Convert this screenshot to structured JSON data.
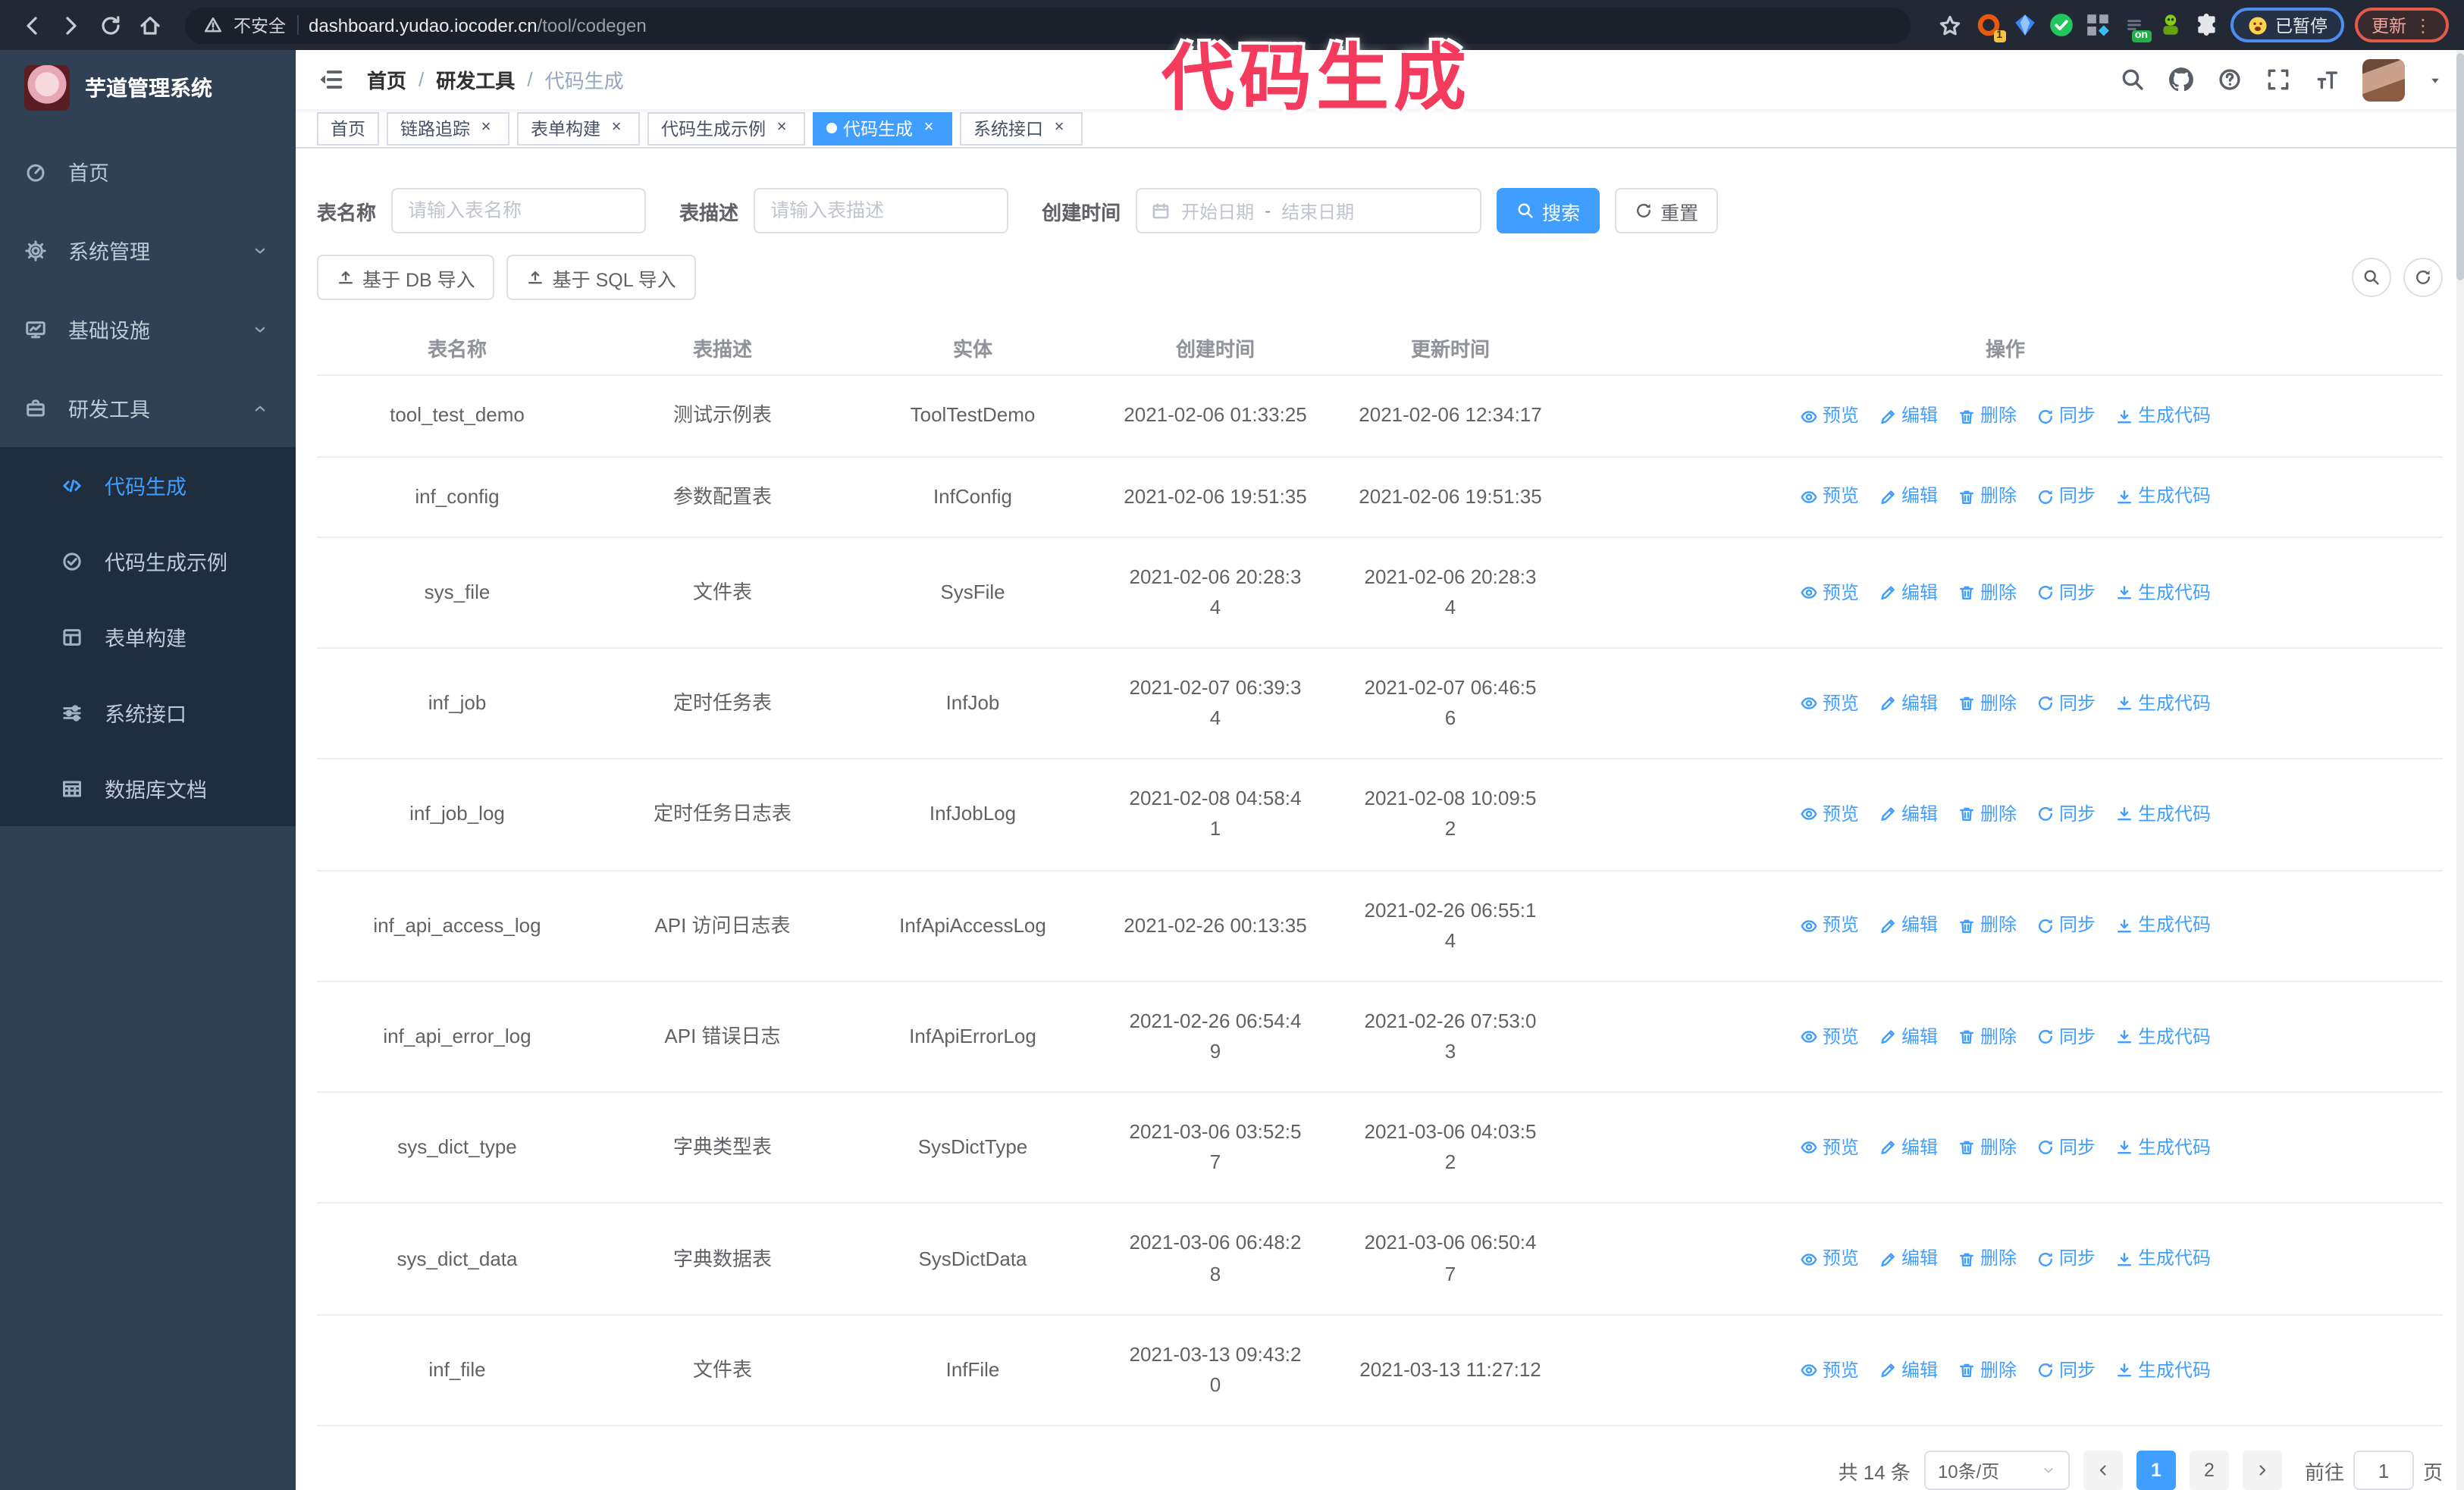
{
  "browser": {
    "security_label": "不安全",
    "url_host": "dashboard.yudao.iocoder.cn",
    "url_path": "/tool/codegen",
    "paused_badge": "已暂停",
    "update_button": "更新"
  },
  "overlay_title": "代码生成",
  "sidebar": {
    "app_title": "芋道管理系统",
    "items": [
      {
        "id": "home",
        "label": "首页",
        "icon": "dashboard-icon",
        "type": "item"
      },
      {
        "id": "system-management",
        "label": "系统管理",
        "icon": "gear-icon",
        "type": "group",
        "expanded": false
      },
      {
        "id": "infrastructure",
        "label": "基础设施",
        "icon": "monitor-icon",
        "type": "group",
        "expanded": false
      },
      {
        "id": "dev-tools",
        "label": "研发工具",
        "icon": "toolbox-icon",
        "type": "group",
        "expanded": true,
        "children": [
          {
            "id": "codegen",
            "label": "代码生成",
            "icon": "code-icon",
            "active": true
          },
          {
            "id": "codegen-example",
            "label": "代码生成示例",
            "icon": "badge-check-icon"
          },
          {
            "id": "form-builder",
            "label": "表单构建",
            "icon": "form-icon"
          },
          {
            "id": "system-api",
            "label": "系统接口",
            "icon": "sliders-icon"
          },
          {
            "id": "db-doc",
            "label": "数据库文档",
            "icon": "database-icon"
          }
        ]
      }
    ]
  },
  "header": {
    "breadcrumb": [
      "首页",
      "研发工具",
      "代码生成"
    ],
    "breadcrumb_separator": "/"
  },
  "tabs": [
    {
      "id": "home",
      "label": "首页",
      "closable": false,
      "active": false
    },
    {
      "id": "tracing",
      "label": "链路追踪",
      "closable": true,
      "active": false
    },
    {
      "id": "form-builder",
      "label": "表单构建",
      "closable": true,
      "active": false
    },
    {
      "id": "codegen-example",
      "label": "代码生成示例",
      "closable": true,
      "active": false
    },
    {
      "id": "codegen",
      "label": "代码生成",
      "closable": true,
      "active": true
    },
    {
      "id": "system-api",
      "label": "系统接口",
      "closable": true,
      "active": false
    }
  ],
  "filters": {
    "table_name_label": "表名称",
    "table_name_placeholder": "请输入表名称",
    "table_desc_label": "表描述",
    "table_desc_placeholder": "请输入表描述",
    "create_time_label": "创建时间",
    "start_placeholder": "开始日期",
    "range_separator": "-",
    "end_placeholder": "结束日期",
    "search_label": "搜索",
    "reset_label": "重置"
  },
  "toolbar": {
    "import_db_label": "基于 DB 导入",
    "import_sql_label": "基于 SQL 导入"
  },
  "table": {
    "columns": [
      "表名称",
      "表描述",
      "实体",
      "创建时间",
      "更新时间",
      "操作"
    ],
    "actions": [
      {
        "id": "preview",
        "label": "预览",
        "icon": "eye-icon"
      },
      {
        "id": "edit",
        "label": "编辑",
        "icon": "edit-icon"
      },
      {
        "id": "delete",
        "label": "删除",
        "icon": "delete-icon"
      },
      {
        "id": "sync",
        "label": "同步",
        "icon": "sync-icon"
      },
      {
        "id": "generate",
        "label": "生成代码",
        "icon": "download-icon"
      }
    ],
    "rows": [
      {
        "name": "tool_test_demo",
        "desc": "测试示例表",
        "entity": "ToolTestDemo",
        "created": "2021-02-06 01:33:25",
        "updated": "2021-02-06 12:34:17"
      },
      {
        "name": "inf_config",
        "desc": "参数配置表",
        "entity": "InfConfig",
        "created": "2021-02-06 19:51:35",
        "updated": "2021-02-06 19:51:35"
      },
      {
        "name": "sys_file",
        "desc": "文件表",
        "entity": "SysFile",
        "created": "2021-02-06 20:28:3\n4",
        "updated": "2021-02-06 20:28:3\n4"
      },
      {
        "name": "inf_job",
        "desc": "定时任务表",
        "entity": "InfJob",
        "created": "2021-02-07 06:39:3\n4",
        "updated": "2021-02-07 06:46:5\n6"
      },
      {
        "name": "inf_job_log",
        "desc": "定时任务日志表",
        "entity": "InfJobLog",
        "created": "2021-02-08 04:58:4\n1",
        "updated": "2021-02-08 10:09:5\n2"
      },
      {
        "name": "inf_api_access_log",
        "desc": "API 访问日志表",
        "entity": "InfApiAccessLog",
        "created": "2021-02-26 00:13:35",
        "updated": "2021-02-26 06:55:1\n4"
      },
      {
        "name": "inf_api_error_log",
        "desc": "API 错误日志",
        "entity": "InfApiErrorLog",
        "created": "2021-02-26 06:54:4\n9",
        "updated": "2021-02-26 07:53:0\n3"
      },
      {
        "name": "sys_dict_type",
        "desc": "字典类型表",
        "entity": "SysDictType",
        "created": "2021-03-06 03:52:5\n7",
        "updated": "2021-03-06 04:03:5\n2"
      },
      {
        "name": "sys_dict_data",
        "desc": "字典数据表",
        "entity": "SysDictData",
        "created": "2021-03-06 06:48:2\n8",
        "updated": "2021-03-06 06:50:4\n7"
      },
      {
        "name": "inf_file",
        "desc": "文件表",
        "entity": "InfFile",
        "created": "2021-03-13 09:43:2\n0",
        "updated": "2021-03-13 11:27:12"
      }
    ]
  },
  "pagination": {
    "total_label": "共 14 条",
    "page_size": "10条/页",
    "pages": [
      "1",
      "2"
    ],
    "active_page": "1",
    "goto_label": "前往",
    "goto_value": "1",
    "page_suffix": "页"
  },
  "colors": {
    "accent": "#409eff",
    "sidebar_bg": "#304156",
    "submenu_bg": "#1f2d3d",
    "annotation": "#f43b5e",
    "chrome_bg": "#222834",
    "tab_active": "#409eff"
  }
}
